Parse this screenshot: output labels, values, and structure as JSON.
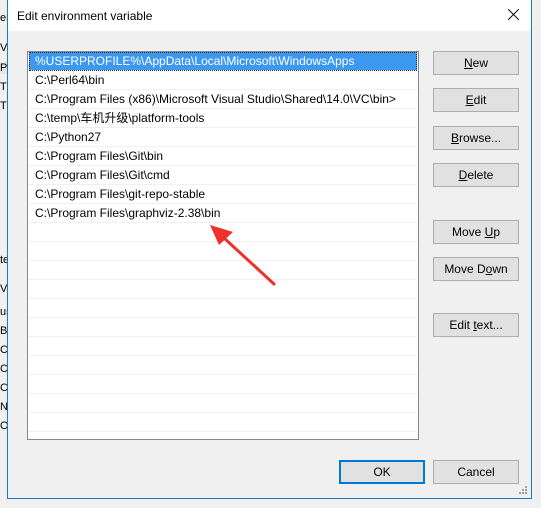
{
  "dialog": {
    "title": "Edit environment variable",
    "close_icon": "close-icon"
  },
  "list": {
    "items": [
      "%USERPROFILE%\\AppData\\Local\\Microsoft\\WindowsApps",
      "C:\\Perl64\\bin",
      "C:\\Program Files (x86)\\Microsoft Visual Studio\\Shared\\14.0\\VC\\bin>",
      "C:\\temp\\车机升级\\platform-tools",
      "C:\\Python27",
      "C:\\Program Files\\Git\\bin",
      "C:\\Program Files\\Git\\cmd",
      "C:\\Program Files\\git-repo-stable",
      "C:\\Program Files\\graphviz-2.38\\bin",
      "",
      "",
      "",
      "",
      "",
      "",
      "",
      "",
      "",
      "",
      ""
    ],
    "selected_index": 0,
    "selection_color": "#3d99ef"
  },
  "buttons": {
    "new": {
      "pre": "",
      "accel": "N",
      "post": "ew"
    },
    "edit": {
      "pre": "",
      "accel": "E",
      "post": "dit"
    },
    "browse": {
      "pre": "",
      "accel": "B",
      "post": "rowse..."
    },
    "delete": {
      "pre": "",
      "accel": "D",
      "post": "elete"
    },
    "move_up": {
      "pre": "Move ",
      "accel": "U",
      "post": "p"
    },
    "move_down": {
      "pre": "Move D",
      "accel": "o",
      "post": "wn"
    },
    "edit_text": {
      "pre": "Edit ",
      "accel": "t",
      "post": "ext..."
    },
    "ok": "OK",
    "cancel": "Cancel"
  },
  "background_fragments": [
    "er",
    "Va",
    "Pa",
    "TE",
    "TM",
    "te",
    "Va",
    "us",
    "BC",
    "CA",
    "CA",
    "Co",
    "NI",
    "OS"
  ],
  "annotation": {
    "type": "red-arrow",
    "color": "#f0302a",
    "points_to": "C:\\Program Files\\graphviz-2.38\\bin"
  },
  "accent_color": "#0078d7"
}
